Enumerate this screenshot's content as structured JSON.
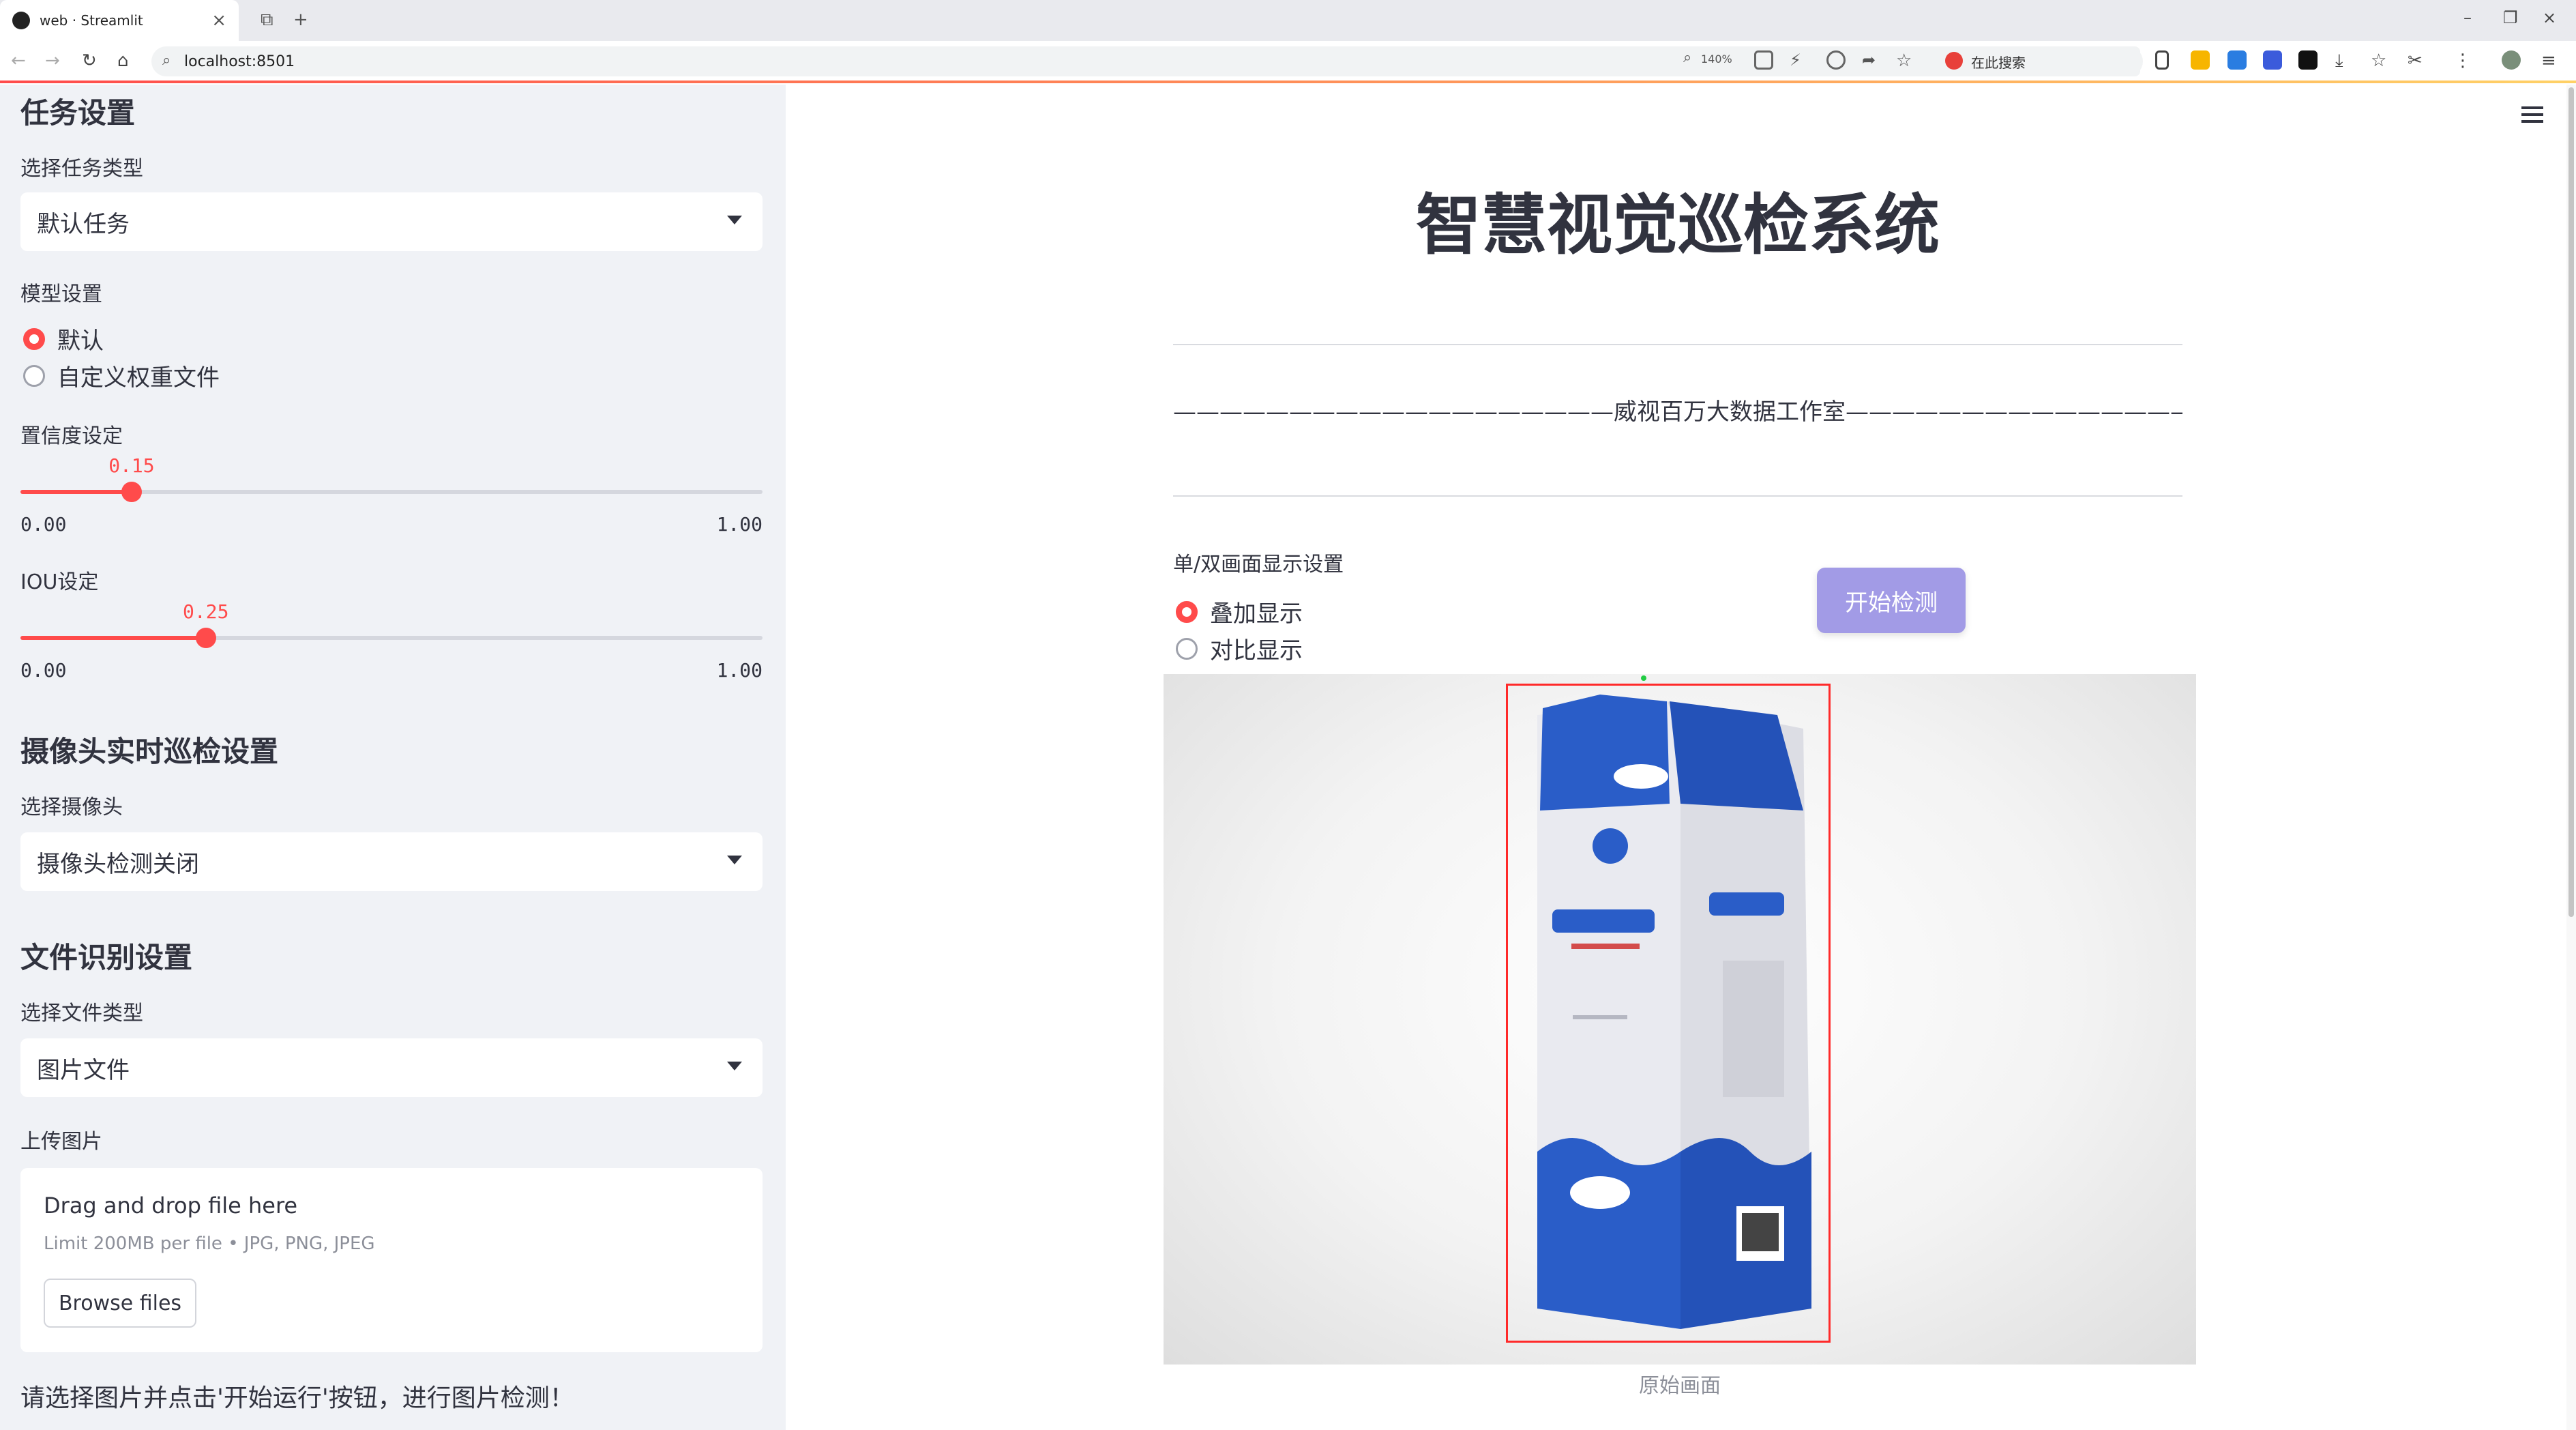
{
  "browser": {
    "tab_title": "web · Streamlit",
    "url": "localhost:8501",
    "zoom": "140%",
    "search_text": "在此搜索"
  },
  "sidebar": {
    "task_heading": "任务设置",
    "task_type_label": "选择任务类型",
    "task_type_value": "默认任务",
    "model_label": "模型设置",
    "model_options": [
      "默认",
      "自定义权重文件"
    ],
    "model_selected": "默认",
    "confidence": {
      "label": "置信度设定",
      "value": "0.15",
      "min": "0.00",
      "max": "1.00",
      "fraction": 0.15
    },
    "iou": {
      "label": "IOU设定",
      "value": "0.25",
      "min": "0.00",
      "max": "1.00",
      "fraction": 0.25
    },
    "camera_heading": "摄像头实时巡检设置",
    "camera_label": "选择摄像头",
    "camera_value": "摄像头检测关闭",
    "file_heading": "文件识别设置",
    "file_type_label": "选择文件类型",
    "file_type_value": "图片文件",
    "upload_label": "上传图片",
    "upload": {
      "title": "Drag and drop file here",
      "limit": "Limit 200MB per file • JPG, PNG, JPEG",
      "browse": "Browse files"
    },
    "hint": "请选择图片并点击'开始运行'按钮，进行图片检测！"
  },
  "main": {
    "title": "智慧视觉巡检系统",
    "studio_line": "———————————————————威视百万大数据工作室————————————————————",
    "display_label": "单/双画面显示设置",
    "display_options": [
      "叠加显示",
      "对比显示"
    ],
    "display_selected": "叠加显示",
    "start_button": "开始检测",
    "image_caption": "原始画面",
    "image_subject": "milk carton",
    "detection_color": "#ff2a2a"
  },
  "colors": {
    "accent": "#ff4b4b",
    "button": "#a29be6",
    "sidebar_bg": "#f0f2f6"
  }
}
